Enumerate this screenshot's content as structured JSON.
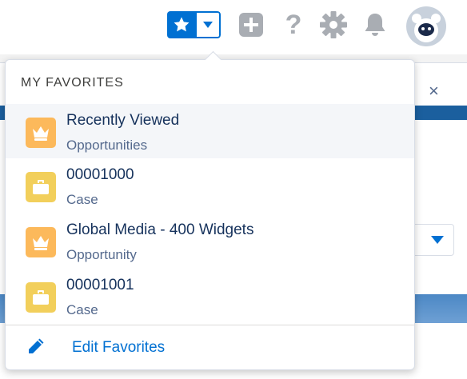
{
  "header": {
    "favorites_button_icon": "star-icon",
    "favorites_menu_icon": "caret-down-icon",
    "global_actions_icon": "plus-square-icon",
    "help_icon": "?",
    "setup_icon": "gear-icon",
    "notifications_icon": "bell-icon",
    "avatar_icon": "user-avatar"
  },
  "colors": {
    "brand_blue": "#0070d2",
    "opportunity_icon": "#fcb95b",
    "case_icon": "#f2cf5b",
    "title_text": "#16325c",
    "subtitle_text": "#54698d",
    "header_icon_grey": "#a9adb3"
  },
  "favorites": {
    "heading": "MY FAVORITES",
    "items": [
      {
        "title": "Recently Viewed",
        "subtitle": "Opportunities",
        "icon": "crown-icon",
        "type": "opportunity"
      },
      {
        "title": "00001000",
        "subtitle": "Case",
        "icon": "briefcase-icon",
        "type": "case"
      },
      {
        "title": "Global Media - 400 Widgets",
        "subtitle": "Opportunity",
        "icon": "crown-icon",
        "type": "opportunity"
      },
      {
        "title": "00001001",
        "subtitle": "Case",
        "icon": "briefcase-icon",
        "type": "case"
      }
    ],
    "edit_label": "Edit Favorites",
    "edit_icon": "pencil-icon"
  },
  "background": {
    "close_symbol": "×",
    "chevron_symbol": "▾"
  }
}
